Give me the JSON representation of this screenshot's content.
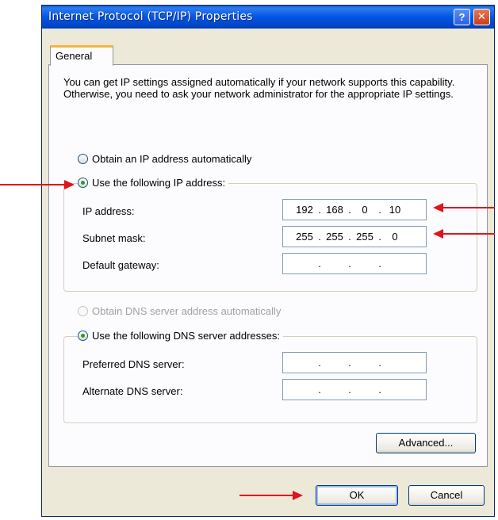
{
  "window": {
    "title": "Internet Protocol (TCP/IP) Properties",
    "help_label": "?",
    "close_label": "✕"
  },
  "tabs": [
    {
      "label": "General"
    }
  ],
  "intro": "You can get IP settings assigned automatically if your network supports this capability. Otherwise, you need to ask your network administrator for the appropriate IP settings.",
  "ip_section": {
    "auto_label": "Obtain an IP address automatically",
    "manual_label": "Use the following IP address:",
    "selected": "manual",
    "fields": [
      {
        "label": "IP address:",
        "octets": [
          "192",
          "168",
          "0",
          "10"
        ]
      },
      {
        "label": "Subnet mask:",
        "octets": [
          "255",
          "255",
          "255",
          "0"
        ]
      },
      {
        "label": "Default gateway:",
        "octets": [
          "",
          "",
          "",
          ""
        ]
      }
    ]
  },
  "dns_section": {
    "auto_label": "Obtain DNS server address automatically",
    "manual_label": "Use the following DNS server addresses:",
    "selected": "manual",
    "auto_disabled": true,
    "fields": [
      {
        "label": "Preferred DNS server:",
        "octets": [
          "",
          "",
          "",
          ""
        ]
      },
      {
        "label": "Alternate DNS server:",
        "octets": [
          "",
          "",
          "",
          ""
        ]
      }
    ]
  },
  "buttons": {
    "advanced": "Advanced...",
    "ok": "OK",
    "cancel": "Cancel"
  },
  "colors": {
    "titlebar": "#0055e5",
    "arrow": "#e0141b",
    "dialog_bg": "#ece9d8"
  }
}
